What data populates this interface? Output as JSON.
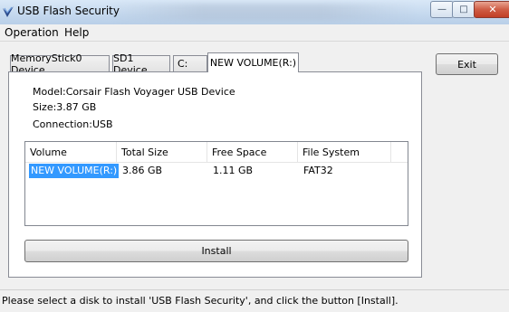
{
  "window": {
    "title": "USB Flash Security",
    "controls": {
      "minimize": "—",
      "maximize": "□",
      "close": "✕"
    }
  },
  "menu": {
    "items": [
      "Operation",
      "Help"
    ]
  },
  "tabs": [
    {
      "label": "MemoryStick0 Device",
      "active": false
    },
    {
      "label": "SD1 Device",
      "active": false
    },
    {
      "label": "C:",
      "active": false
    },
    {
      "label": "NEW VOLUME(R:)",
      "active": true
    }
  ],
  "device": {
    "model": "Model:Corsair Flash Voyager USB Device",
    "size": "Size:3.87 GB",
    "connection": "Connection:USB"
  },
  "volumes": {
    "columns": [
      "Volume",
      "Total Size",
      "Free Space",
      "File System"
    ],
    "rows": [
      {
        "volume": "NEW VOLUME(R:)",
        "total": "3.86 GB",
        "free": "1.11 GB",
        "fs": "FAT32",
        "selected": true
      }
    ]
  },
  "buttons": {
    "install": "Install",
    "exit": "Exit"
  },
  "status": "Please select a disk to install 'USB Flash Security', and click the button [Install].",
  "colors": {
    "selection": "#3399ff",
    "titlebar": "#c4d8ee",
    "close": "#c13f26"
  },
  "icons": {
    "app": "usb-flash-security-icon"
  }
}
